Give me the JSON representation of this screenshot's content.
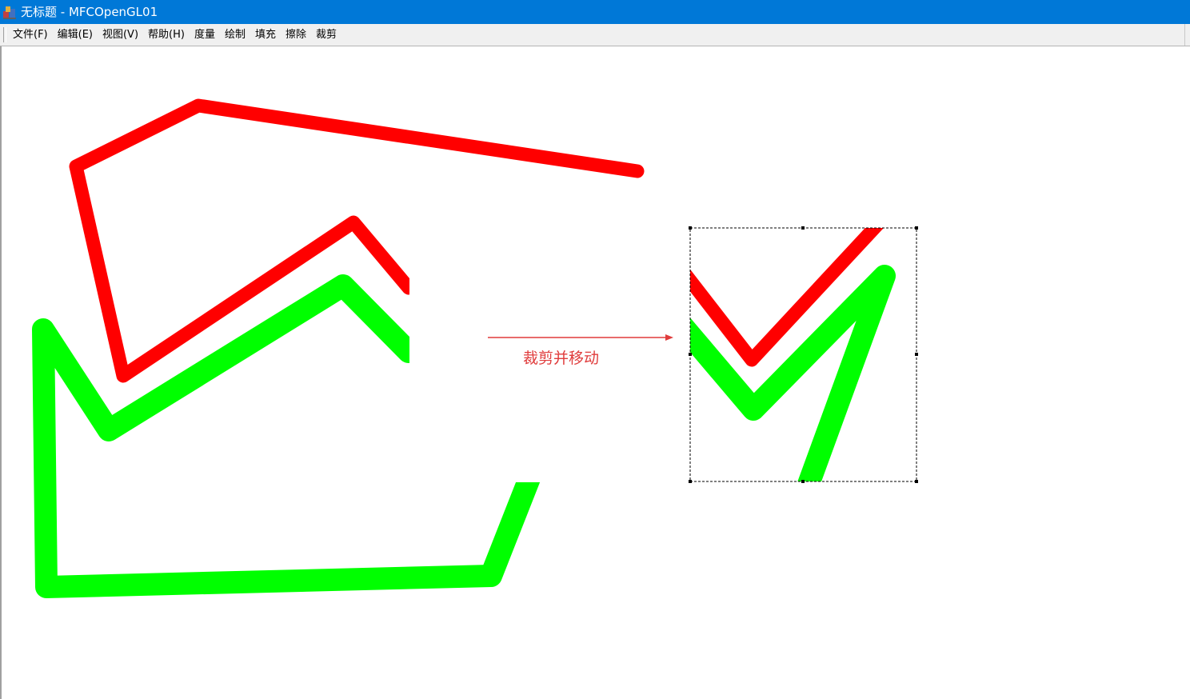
{
  "window": {
    "title": "无标题 - MFCOpenGL01",
    "titlebar_color": "#0078d7",
    "app_icon": "mfc-app-icon"
  },
  "menu": {
    "items": [
      {
        "label": "文件(F)"
      },
      {
        "label": "编辑(E)"
      },
      {
        "label": "视图(V)"
      },
      {
        "label": "帮助(H)"
      },
      {
        "label": "度量"
      },
      {
        "label": "绘制"
      },
      {
        "label": "填充"
      },
      {
        "label": "擦除"
      },
      {
        "label": "裁剪"
      }
    ]
  },
  "canvas": {
    "background": "#ffffff",
    "annotation_text": "裁剪并移动",
    "annotation_color": "#e03c3c",
    "red_polyline_color": "#ff0000",
    "green_polyline_color": "#00ff00",
    "selection_style": "dashed-with-handles"
  }
}
